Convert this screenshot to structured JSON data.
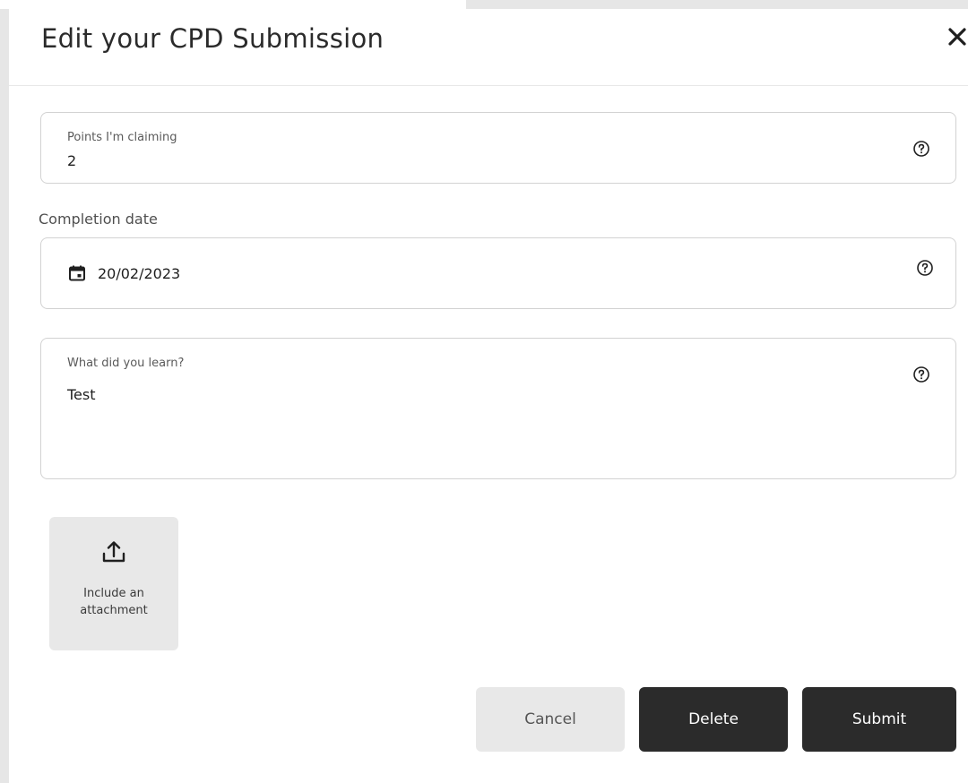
{
  "modal": {
    "title": "Edit your CPD Submission"
  },
  "points": {
    "label": "Points I'm claiming",
    "value": "2"
  },
  "completion": {
    "section_label": "Completion date",
    "value": "20/02/2023"
  },
  "learning": {
    "label": "What did you learn?",
    "value": "Test"
  },
  "attachment": {
    "label_line1": "Include an",
    "label_line2": "attachment"
  },
  "actions": {
    "cancel": "Cancel",
    "delete": "Delete",
    "submit": "Submit"
  },
  "icons": {
    "close": "close-icon",
    "help": "help-circle-icon",
    "calendar": "calendar-icon",
    "upload": "upload-icon"
  },
  "colors": {
    "primary_button": "#2b2b2b",
    "secondary_button": "#e8e8e8",
    "border": "#d2d2d2"
  }
}
